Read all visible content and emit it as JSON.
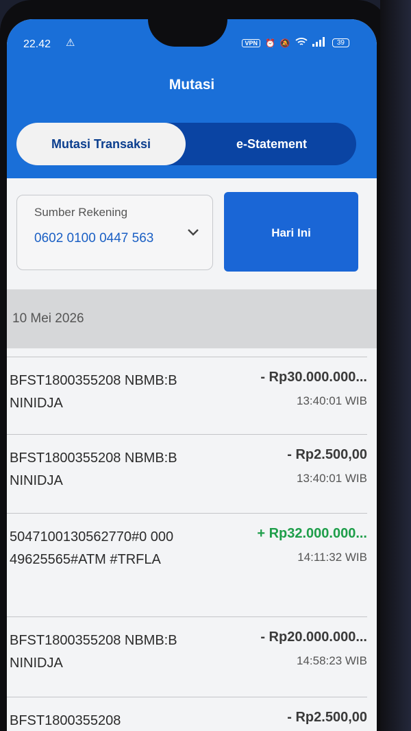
{
  "status_bar": {
    "time": "22.42",
    "alert": "⚠",
    "vpn": "VPN",
    "battery": "39"
  },
  "header": {
    "title": "Mutasi"
  },
  "tabs": [
    {
      "label": "Mutasi Transaksi",
      "active": true
    },
    {
      "label": "e-Statement",
      "active": false
    }
  ],
  "filter": {
    "source_label": "Sumber Rekening",
    "source_value": "0602 0100 0447 563",
    "period_button": "Hari Ini"
  },
  "date_group": "10 Mei 2026",
  "transactions": [
    {
      "description": "BFST1800355208 NBMB:BNINIDJA",
      "amount": "- Rp30.000.000...",
      "time": "13:40:01 WIB",
      "type": "debit"
    },
    {
      "description": "BFST1800355208 NBMB:BNINIDJA",
      "amount": "- Rp2.500,00",
      "time": "13:40:01 WIB",
      "type": "debit"
    },
    {
      "description": "5047100130562770#0 00049625565#ATM #TRFLA",
      "amount": "+ Rp32.000.000...",
      "time": "14:11:32 WIB",
      "type": "credit"
    },
    {
      "description": "BFST1800355208 NBMB:BNINIDJA",
      "amount": "- Rp20.000.000...",
      "time": "14:58:23 WIB",
      "type": "debit"
    },
    {
      "description": "BFST1800355208",
      "amount": "- Rp2.500,00",
      "time": "",
      "type": "debit"
    }
  ],
  "colors": {
    "primary": "#1a6fd8",
    "tab_dark": "#0a44a3",
    "credit": "#1e9e4a"
  }
}
